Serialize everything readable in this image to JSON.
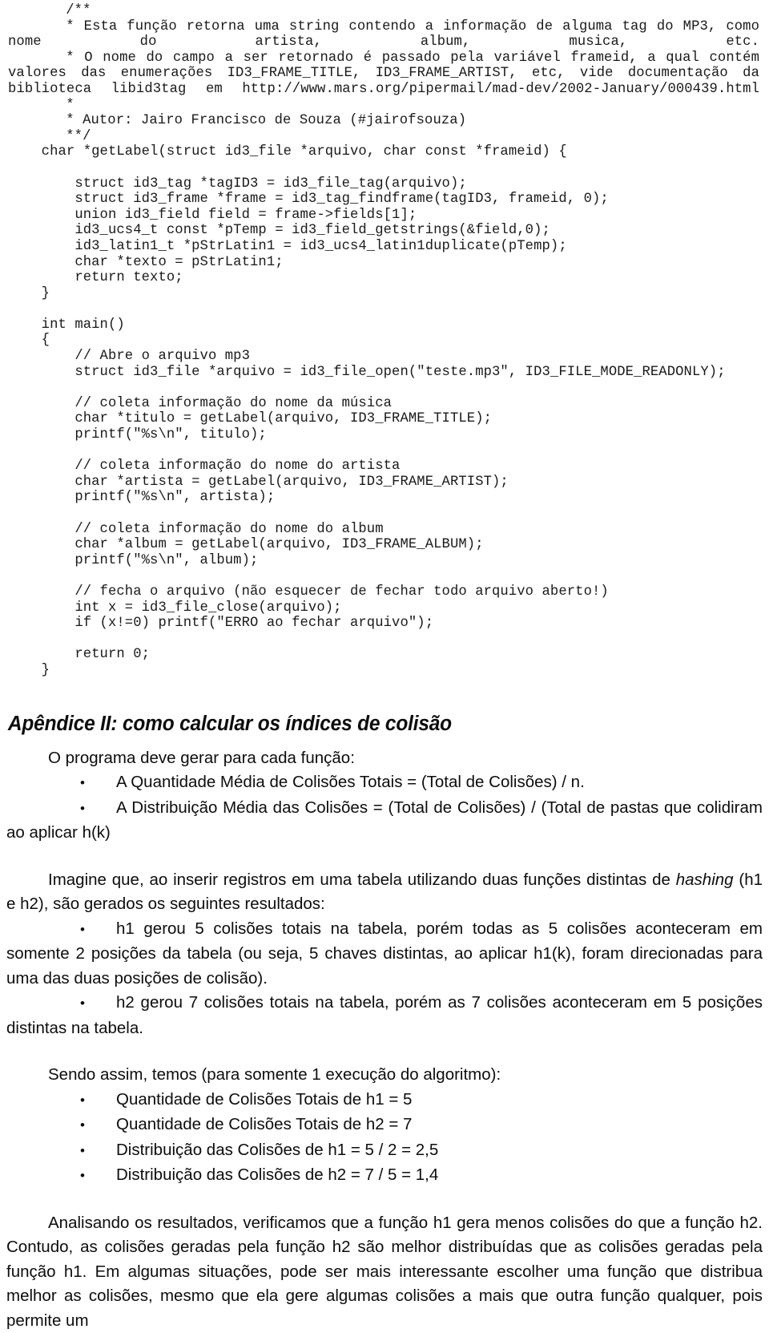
{
  "document": {
    "code_listing": {
      "comment_lines": [
        "/**",
        "* Esta função retorna uma string contendo a informação de alguma tag do MP3, como nome do artista, album, musica, etc.",
        "* O nome do campo a ser retornado é passado pela variável frameid, a qual contém valores das enumerações ID3_FRAME_TITLE, ID3_FRAME_ARTIST, etc, vide documentação da biblioteca libid3tag em http://www.mars.org/pipermail/mad-dev/2002-January/000439.html",
        "*",
        "* Autor: Jairo Francisco de Souza (#jairofsouza)",
        "**/"
      ],
      "comment_para_1": "* Esta função retorna uma string contendo a informação de alguma tag do MP3, como nome do artista, album, musica, etc.",
      "comment_para_2": "* O nome do campo a ser retornado é passado pela variável frameid, a qual contém valores das enumerações ID3_FRAME_TITLE, ID3_FRAME_ARTIST, etc, vide documentação da biblioteca libid3tag em http://www.mars.org/pipermail/mad-dev/2002-January/000439.html",
      "comment_open": "/**",
      "comment_star": "*",
      "comment_author": "* Autor: Jairo Francisco de Souza (#jairofsouza)",
      "comment_close": "**/",
      "getlabel_body": "    char *getLabel(struct id3_file *arquivo, char const *frameid) {\n\n        struct id3_tag *tagID3 = id3_file_tag(arquivo);\n        struct id3_frame *frame = id3_tag_findframe(tagID3, frameid, 0);\n        union id3_field field = frame->fields[1];\n        id3_ucs4_t const *pTemp = id3_field_getstrings(&field,0);\n        id3_latin1_t *pStrLatin1 = id3_ucs4_latin1duplicate(pTemp);\n        char *texto = pStrLatin1;\n        return texto;\n    }",
      "main_body": "    int main()\n    {\n        // Abre o arquivo mp3\n        struct id3_file *arquivo = id3_file_open(\"teste.mp3\", ID3_FILE_MODE_READONLY);\n\n        // coleta informação do nome da música\n        char *titulo = getLabel(arquivo, ID3_FRAME_TITLE);\n        printf(\"%s\\n\", titulo);\n\n        // coleta informação do nome do artista\n        char *artista = getLabel(arquivo, ID3_FRAME_ARTIST);\n        printf(\"%s\\n\", artista);\n\n        // coleta informação do nome do album\n        char *album = getLabel(arquivo, ID3_FRAME_ALBUM);\n        printf(\"%s\\n\", album);\n\n        // fecha o arquivo (não esquecer de fechar todo arquivo aberto!)\n        int x = id3_file_close(arquivo);\n        if (x!=0) printf(\"ERRO ao fechar arquivo\");\n\n        return 0;\n    }"
    },
    "appendix": {
      "heading": "Apêndice II: como calcular os índices de colisão",
      "intro": "O programa deve gerar para cada função:",
      "formula_bullets": [
        "A Quantidade Média de Colisões Totais = (Total de Colisões) / n.",
        "A Distribuição Média das Colisões = (Total de Colisões) / (Total de pastas que colidiram ao aplicar h(k)"
      ],
      "example_intro_before_italic": "Imagine que, ao inserir registros em uma tabela utilizando duas funções distintas de ",
      "example_intro_italic": "hashing",
      "example_intro_after_italic": " (h1 e h2), são gerados os seguintes resultados:",
      "example_bullets": [
        "h1 gerou 5 colisões totais na tabela, porém todas as 5 colisões aconteceram em somente 2 posições da tabela (ou seja, 5 chaves distintas, ao aplicar h1(k), foram direcionadas para uma das duas posições de colisão).",
        "h2 gerou 7 colisões totais na tabela, porém as 7 colisões aconteceram em 5 posições distintas na tabela."
      ],
      "results_intro": "Sendo assim, temos (para somente 1 execução do algoritmo):",
      "results": [
        "Quantidade de Colisões Totais de h1 = 5",
        "Quantidade de Colisões Totais de h2 = 7",
        "Distribuição das Colisões de h1 = 5 / 2 = 2,5",
        "Distribuição das Colisões de h2 = 7 / 5 = 1,4"
      ],
      "conclusion": "Analisando os resultados, verificamos que a função h1 gera menos colisões do que a função h2. Contudo, as colisões geradas pela função h2 são melhor distribuídas que as colisões geradas pela função h1. Em algumas situações, pode ser mais interessante escolher uma função que distribua melhor as colisões, mesmo que ela gere algumas colisões a mais que outra função qualquer, pois permite um"
    }
  }
}
